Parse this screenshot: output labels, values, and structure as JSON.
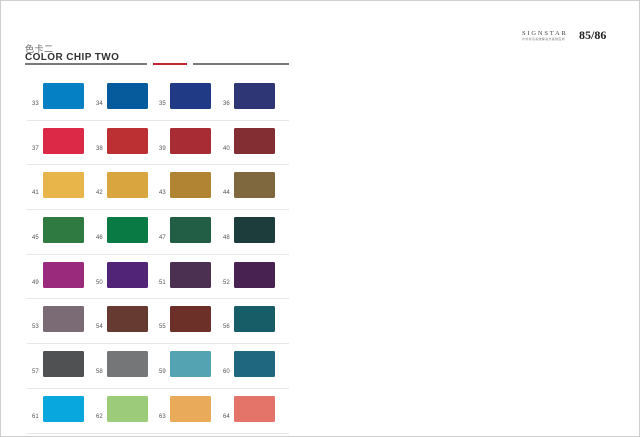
{
  "header": {
    "title_cn": "色卡二",
    "title_en": "COLOR CHIP TWO",
    "brand_name": "SIGNSTAR",
    "brand_subtitle": "户外标识系统解决方案供应商",
    "page_number": "85/86",
    "rule_accent_color": "#c0262d"
  },
  "rows": [
    {
      "chips": [
        {
          "number": "33",
          "color": "#0680c5"
        },
        {
          "number": "34",
          "color": "#065b9c"
        },
        {
          "number": "35",
          "color": "#213a86"
        },
        {
          "number": "36",
          "color": "#2f3675"
        }
      ]
    },
    {
      "chips": [
        {
          "number": "37",
          "color": "#db2947"
        },
        {
          "number": "38",
          "color": "#bc2f32"
        },
        {
          "number": "39",
          "color": "#a72c33"
        },
        {
          "number": "40",
          "color": "#832e33"
        }
      ]
    },
    {
      "chips": [
        {
          "number": "41",
          "color": "#e7b549"
        },
        {
          "number": "42",
          "color": "#d9a53f"
        },
        {
          "number": "43",
          "color": "#b08432"
        },
        {
          "number": "44",
          "color": "#7f683e"
        }
      ]
    },
    {
      "chips": [
        {
          "number": "45",
          "color": "#2f7a40"
        },
        {
          "number": "46",
          "color": "#097a43"
        },
        {
          "number": "47",
          "color": "#225e45"
        },
        {
          "number": "48",
          "color": "#1c3d3c"
        }
      ]
    },
    {
      "chips": [
        {
          "number": "49",
          "color": "#9a2b7c"
        },
        {
          "number": "50",
          "color": "#522478"
        },
        {
          "number": "51",
          "color": "#4c3052"
        },
        {
          "number": "52",
          "color": "#482250"
        }
      ]
    },
    {
      "chips": [
        {
          "number": "53",
          "color": "#7b6b74"
        },
        {
          "number": "54",
          "color": "#663a31"
        },
        {
          "number": "55",
          "color": "#6c3029"
        },
        {
          "number": "56",
          "color": "#175d67"
        }
      ]
    },
    {
      "chips": [
        {
          "number": "57",
          "color": "#505152"
        },
        {
          "number": "58",
          "color": "#747678"
        },
        {
          "number": "59",
          "color": "#53a3b2"
        },
        {
          "number": "60",
          "color": "#1f677e"
        }
      ]
    },
    {
      "chips": [
        {
          "number": "61",
          "color": "#08a8de"
        },
        {
          "number": "62",
          "color": "#9ccb7a"
        },
        {
          "number": "63",
          "color": "#e9aa5a"
        },
        {
          "number": "64",
          "color": "#e47469"
        }
      ]
    }
  ]
}
